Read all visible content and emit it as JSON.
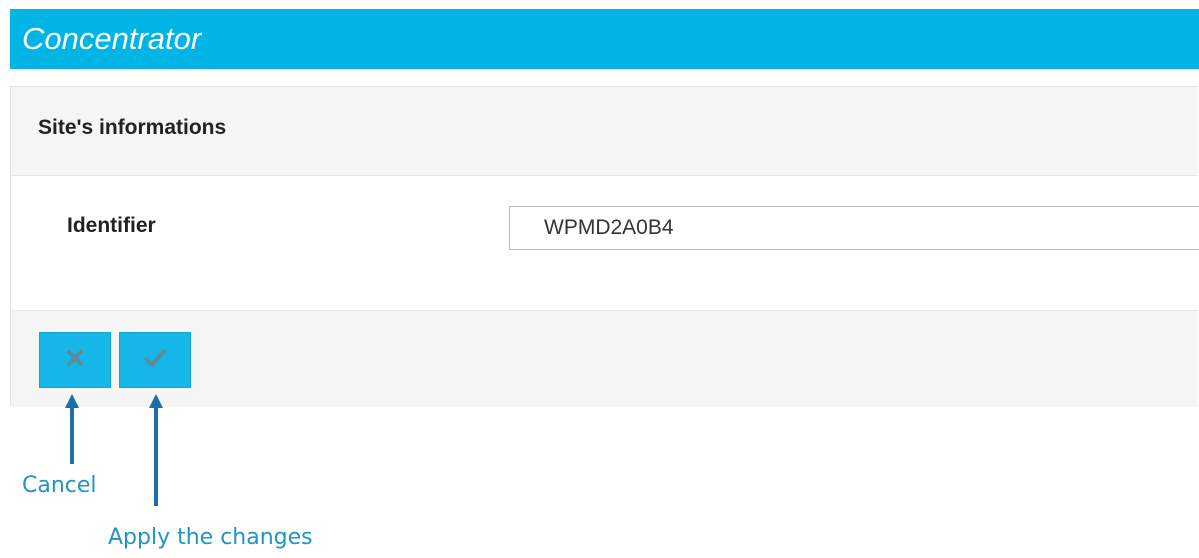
{
  "header": {
    "title": "Concentrator"
  },
  "panel": {
    "heading": "Site's informations",
    "fields": [
      {
        "label": "Identifier",
        "value": "WPMD2A0B4"
      }
    ]
  },
  "footer": {
    "cancel_icon": "close-icon",
    "apply_icon": "check-icon"
  },
  "annotations": {
    "cancel": "Cancel",
    "apply": "Apply the changes"
  },
  "colors": {
    "header_bg": "#00b5e6",
    "button_bg": "#17b6e8",
    "annotation_text": "#1f95c4",
    "arrow": "#1a6fa6"
  }
}
